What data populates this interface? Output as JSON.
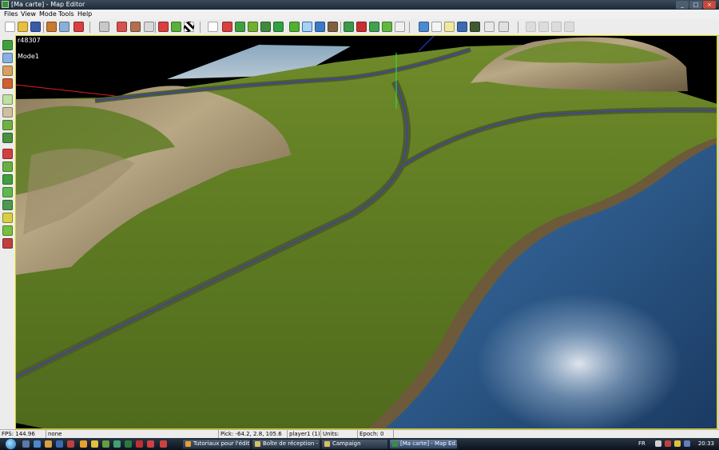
{
  "window": {
    "title": "[Ma carte] - Map Editor"
  },
  "menu": {
    "items": [
      "Files",
      "View",
      "Mode",
      "Tools",
      "Help"
    ]
  },
  "viewport": {
    "info_line1": "r48307",
    "info_line2": "Mode1"
  },
  "status": {
    "fps": "FPS: 144.96",
    "selection": "none",
    "pick": "Pick: -64.2, 2.8, 105.6",
    "player": "player1 (1)",
    "units": "Units:",
    "epoch": "Epoch: 0"
  },
  "taskbar": {
    "tasks": [
      "Tutoriaux pour l'édit...",
      "Boîte de réception - ...",
      "Campaign",
      "[Ma carte] - Map Ed..."
    ],
    "lang": "FR",
    "time": "20:33"
  },
  "colors": {
    "grass": "#5d7a22",
    "water": "#2d5a8a",
    "road": "#3a3acd"
  }
}
